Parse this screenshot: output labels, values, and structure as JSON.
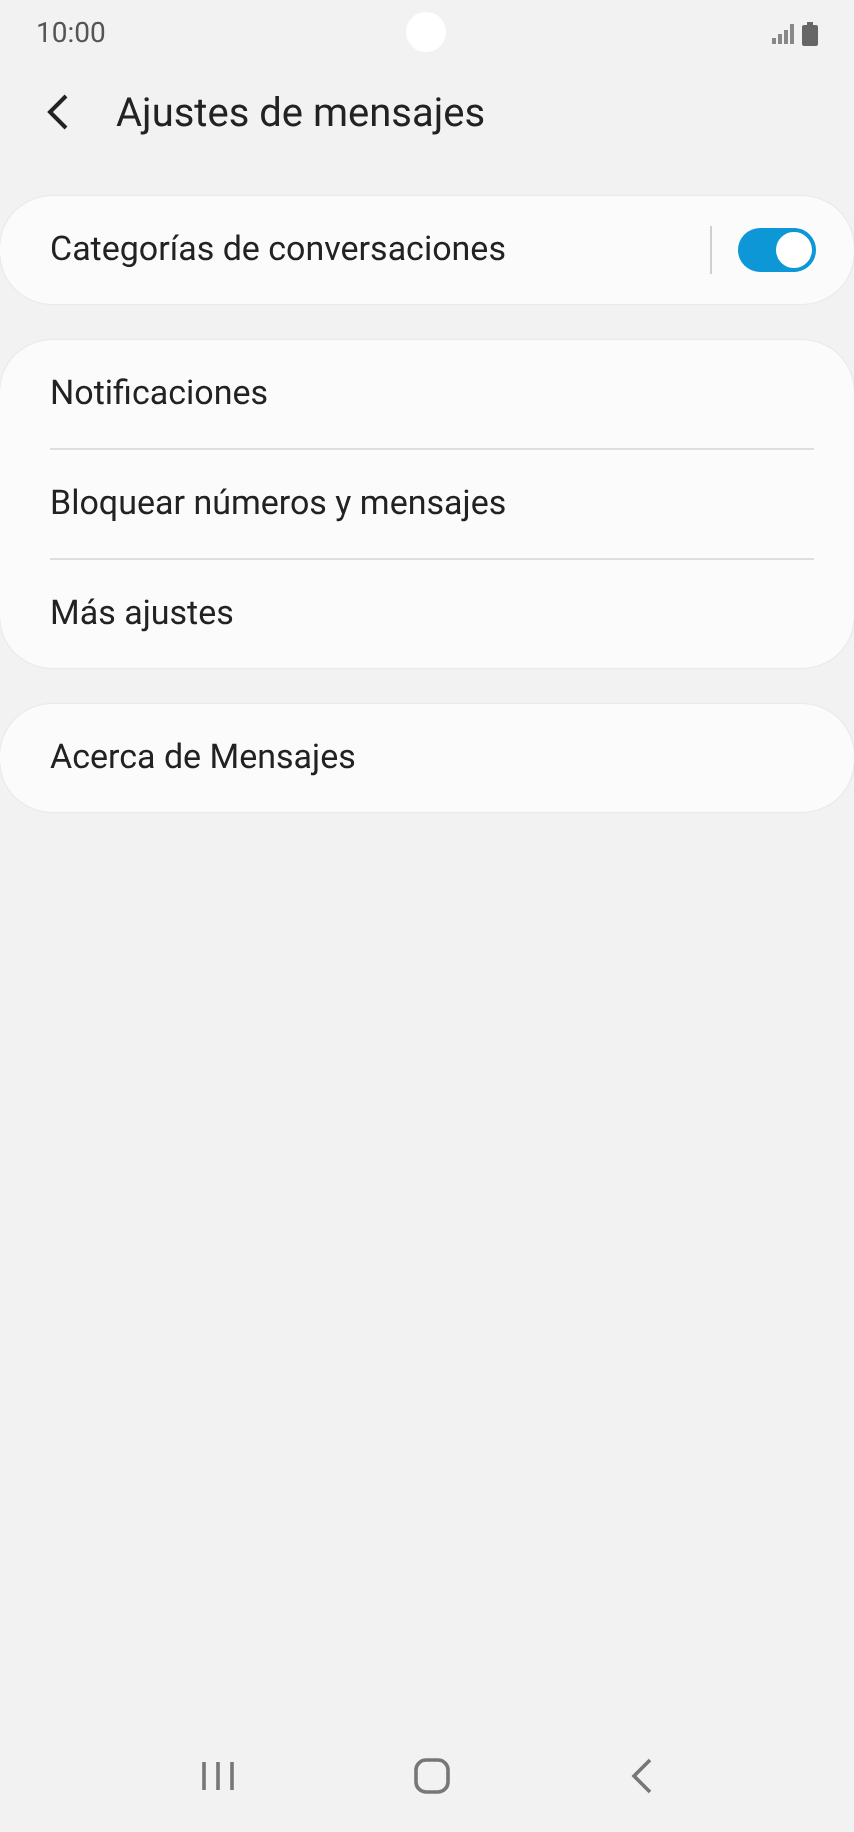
{
  "status_bar": {
    "time": "10:00"
  },
  "header": {
    "title": "Ajustes de mensajes"
  },
  "groups": [
    {
      "items": [
        {
          "label": "Categorías de conversaciones",
          "kind": "toggle",
          "on": true
        }
      ]
    },
    {
      "items": [
        {
          "label": "Notificaciones",
          "kind": "link"
        },
        {
          "label": "Bloquear números y mensajes",
          "kind": "link"
        },
        {
          "label": "Más ajustes",
          "kind": "link"
        }
      ]
    },
    {
      "items": [
        {
          "label": "Acerca de Mensajes",
          "kind": "link"
        }
      ]
    }
  ]
}
